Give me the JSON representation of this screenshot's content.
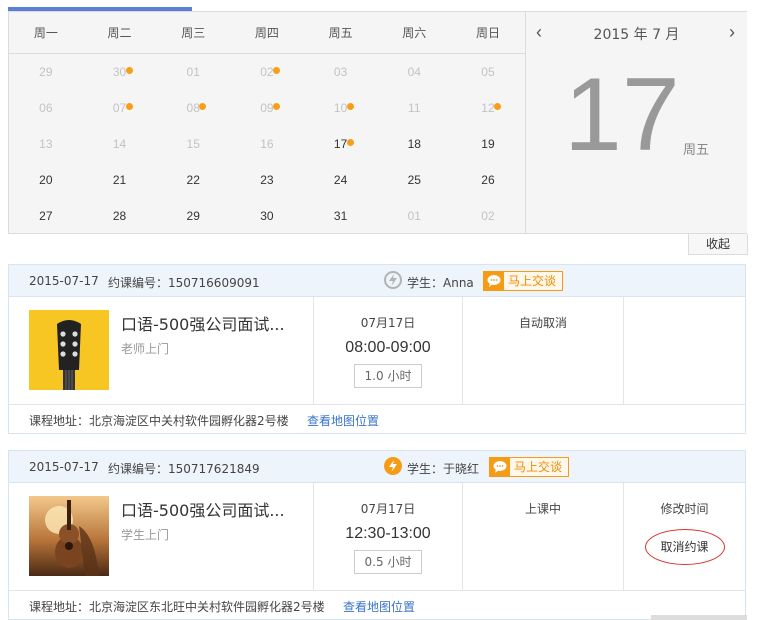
{
  "calendar": {
    "weekdays": [
      "周一",
      "周二",
      "周三",
      "周四",
      "周五",
      "周六",
      "周日"
    ],
    "rows": [
      [
        {
          "d": "29",
          "muted": true,
          "dot": false
        },
        {
          "d": "30",
          "muted": true,
          "dot": true
        },
        {
          "d": "01",
          "muted": true,
          "dot": false
        },
        {
          "d": "02",
          "muted": true,
          "dot": true
        },
        {
          "d": "03",
          "muted": true,
          "dot": false
        },
        {
          "d": "04",
          "muted": true,
          "dot": false
        },
        {
          "d": "05",
          "muted": true,
          "dot": false
        }
      ],
      [
        {
          "d": "06",
          "muted": true,
          "dot": false
        },
        {
          "d": "07",
          "muted": true,
          "dot": true
        },
        {
          "d": "08",
          "muted": true,
          "dot": true
        },
        {
          "d": "09",
          "muted": true,
          "dot": true
        },
        {
          "d": "10",
          "muted": true,
          "dot": true
        },
        {
          "d": "11",
          "muted": true,
          "dot": false
        },
        {
          "d": "12",
          "muted": true,
          "dot": true
        }
      ],
      [
        {
          "d": "13",
          "muted": true,
          "dot": false
        },
        {
          "d": "14",
          "muted": true,
          "dot": false
        },
        {
          "d": "15",
          "muted": true,
          "dot": false
        },
        {
          "d": "16",
          "muted": true,
          "dot": false
        },
        {
          "d": "17",
          "muted": false,
          "dot": true
        },
        {
          "d": "18",
          "muted": false,
          "dot": false
        },
        {
          "d": "19",
          "muted": false,
          "dot": false
        }
      ],
      [
        {
          "d": "20",
          "muted": false,
          "dot": false
        },
        {
          "d": "21",
          "muted": false,
          "dot": false
        },
        {
          "d": "22",
          "muted": false,
          "dot": false
        },
        {
          "d": "23",
          "muted": false,
          "dot": false
        },
        {
          "d": "24",
          "muted": false,
          "dot": false
        },
        {
          "d": "25",
          "muted": false,
          "dot": false
        },
        {
          "d": "26",
          "muted": false,
          "dot": false
        }
      ],
      [
        {
          "d": "27",
          "muted": false,
          "dot": false
        },
        {
          "d": "28",
          "muted": false,
          "dot": false
        },
        {
          "d": "29",
          "muted": false,
          "dot": false
        },
        {
          "d": "30",
          "muted": false,
          "dot": false
        },
        {
          "d": "31",
          "muted": false,
          "dot": false
        },
        {
          "d": "01",
          "muted": true,
          "dot": false
        },
        {
          "d": "02",
          "muted": true,
          "dot": false
        }
      ]
    ],
    "month_label": "2015 年 7 月",
    "selected_day": "17",
    "selected_weekday": "周五",
    "prev_icon": "‹",
    "next_icon": "›",
    "collapse_label": "收起",
    "dot_color": "#f5a016"
  },
  "courses": [
    {
      "date": "2015-07-17",
      "order_label": "约课编号：150716609091",
      "student_label": "学生：Anna",
      "chat_label": "马上交谈",
      "bolt_style": "gray",
      "title": "口语-500强公司面试...",
      "mode": "老师上门",
      "thumb": "guitar-head-icon",
      "time_date": "07月17日",
      "time_range": "08:00-09:00",
      "duration": "1.0 小时",
      "status": "自动取消",
      "ops": [],
      "address": "课程地址：北京海淀区中关村软件园孵化器2号楼",
      "map_link": "查看地图位置"
    },
    {
      "date": "2015-07-17",
      "order_label": "约课编号：150717621849",
      "student_label": "学生：于晓红",
      "chat_label": "马上交谈",
      "bolt_style": "orange",
      "title": "口语-500强公司面试...",
      "mode": "学生上门",
      "thumb": "guitar-photo-icon",
      "time_date": "07月17日",
      "time_range": "12:30-13:00",
      "duration": "0.5 小时",
      "status": "上课中",
      "ops": [
        "修改时间",
        "取消约课"
      ],
      "address": "课程地址：北京海淀区东北旺中关村软件园孵化器2号楼",
      "map_link": "查看地图位置"
    }
  ]
}
